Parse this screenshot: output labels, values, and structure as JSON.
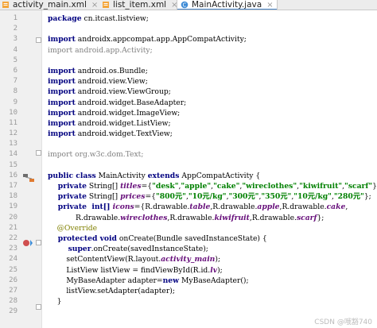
{
  "tabs": [
    {
      "label": "activity_main.xml",
      "icon": "xml-file-icon",
      "close": "×",
      "active": false
    },
    {
      "label": "list_item.xml",
      "icon": "xml-file-icon",
      "close": "×",
      "active": false
    },
    {
      "label": "MainActivity.java",
      "icon": "java-class-icon",
      "close": "×",
      "active": true
    }
  ],
  "line_numbers": [
    "1",
    "2",
    "3",
    "4",
    "5",
    "6",
    "7",
    "8",
    "9",
    "10",
    "11",
    "12",
    "13",
    "14",
    "15",
    "16",
    "17",
    "18",
    "19",
    "20",
    "21",
    "22",
    "23",
    "24",
    "25",
    "26",
    "27",
    "28",
    "29"
  ],
  "code": {
    "l1_kw": "package",
    "l1_rest": " cn.itcast.listview;",
    "l3_kw": "import",
    "l3_rest": " androidx.appcompat.app.AppCompatActivity;",
    "l4_text": "import android.app.Activity;",
    "l6_kw": "import",
    "l6_rest": " android.os.Bundle;",
    "l7_kw": "import",
    "l7_rest": " android.view.View;",
    "l8_kw": "import",
    "l8_rest": " android.view.ViewGroup;",
    "l9_kw": "import",
    "l9_rest": " android.widget.BaseAdapter;",
    "l10_kw": "import",
    "l10_rest": " android.widget.ImageView;",
    "l11_kw": "import",
    "l11_rest": " android.widget.ListView;",
    "l12_kw": "import",
    "l12_rest": " android.widget.TextView;",
    "l14_text": "import org.w3c.dom.Text;",
    "l16_kw1": "public class",
    "l16_mid": " MainActivity ",
    "l16_kw2": "extends",
    "l16_rest": " AppCompatActivity {",
    "l17_kw": "    private",
    "l17_a": " String[] ",
    "l17_f": "titles",
    "l17_b": "={",
    "l17_s1": "\"desk\"",
    "l17_s2": "\"apple\"",
    "l17_s3": "\"cake\"",
    "l17_s4": "\"wireclothes\"",
    "l17_s5": "\"kiwifruit\"",
    "l17_s6": "\"scarf\"",
    "comma": ",",
    "close_arr": "};",
    "l18_kw": "    private",
    "l18_a": " String[] ",
    "l18_f": "prices",
    "l18_b": "={",
    "l18_s1": "\"800元\"",
    "l18_s2": "\"10元/kg\"",
    "l18_s3": "\"300元\"",
    "l18_s4": "\"350元\"",
    "l18_s5": "\"10元/kg\"",
    "l18_s6": "\"280元\"",
    "l19_kw": "    private",
    "l19_a": "  int[] ",
    "l19_f": "icons",
    "l19_b": "={R.drawable.",
    "l19_f1": "table",
    "l19_c": ",R.drawable.",
    "l19_f2": "apple",
    "l19_d": ",R.drawable.",
    "l19_f3": "cake",
    "l19_e": ",",
    "l20_a": "            R.drawable.",
    "l20_f1": "wireclothes",
    "l20_b": ",R.drawable.",
    "l20_f2": "kiwifruit",
    "l20_c": ",R.drawable.",
    "l20_f3": "scarf",
    "l20_d": "};",
    "l21_an": "    @Override",
    "l22_kw": "    protected void",
    "l22_rest": " onCreate(Bundle savedInstanceState) {",
    "l23_kw": "        super",
    "l23_rest": ".onCreate(savedInstanceState);",
    "l24_a": "        setContentView(R.layout.",
    "l24_f": "activity_main",
    "l24_b": ");",
    "l25_a": "        ListView listView = findViewById(R.id.",
    "l25_f": "lv",
    "l25_b": ");",
    "l26_a": "        MyBaseAdapter adapter=",
    "l26_kw": "new",
    "l26_b": " MyBaseAdapter();",
    "l27_a": "        listView.setAdapter(adapter);",
    "l28_a": "    }"
  },
  "watermark": "CSDN @哦豁740",
  "colors": {
    "keyword": "#000080",
    "string": "#008000",
    "field": "#660e7a",
    "comment": "#808080",
    "annotation": "#808000",
    "tab_accent": "#4a86c7"
  }
}
